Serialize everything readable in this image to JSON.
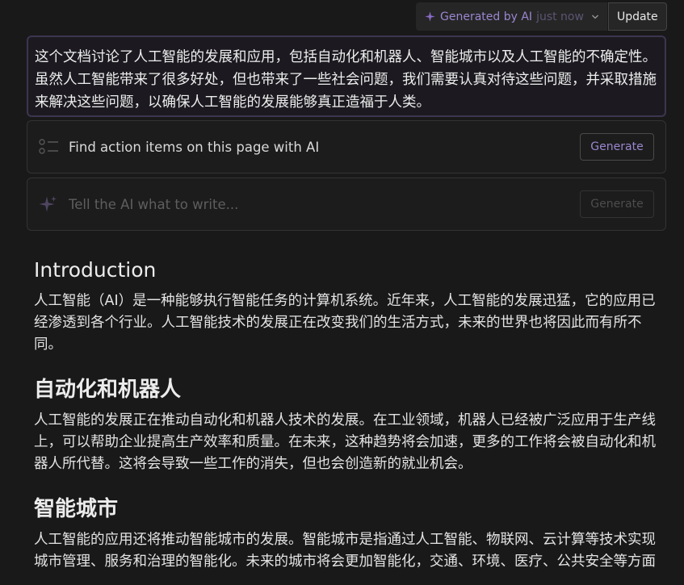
{
  "toolbar": {
    "generated_label": "Generated by AI",
    "generated_time": "just now",
    "update_label": "Update"
  },
  "summary": {
    "text": "这个文档讨论了人工智能的发展和应用，包括自动化和机器人、智能城市以及人工智能的不确定性。虽然人工智能带来了很多好处，但也带来了一些社会问题，我们需要认真对待这些问题，并采取措施来解决这些问题，以确保人工智能的发展能够真正造福于人类。"
  },
  "actions": {
    "find_items_label": "Find action items on this page with AI",
    "find_items_button": "Generate",
    "prompt_placeholder": "Tell the AI what to write...",
    "prompt_button": "Generate"
  },
  "doc": {
    "sections": [
      {
        "heading": "Introduction",
        "body": "人工智能（AI）是一种能够执行智能任务的计算机系统。近年来，人工智能的发展迅猛，它的应用已经渗透到各个行业。人工智能技术的发展正在改变我们的生活方式，未来的世界也将因此而有所不同。"
      },
      {
        "heading": "自动化和机器人",
        "body": "人工智能的发展正在推动自动化和机器人技术的发展。在工业领域，机器人已经被广泛应用于生产线上，可以帮助企业提高生产效率和质量。在未来，这种趋势将会加速，更多的工作将会被自动化和机器人所代替。这将会导致一些工作的消失，但也会创造新的就业机会。"
      },
      {
        "heading": "智能城市",
        "body": "人工智能的应用还将推动智能城市的发展。智能城市是指通过人工智能、物联网、云计算等技术实现城市管理、服务和治理的智能化。未来的城市将会更加智能化，交通、环境、医疗、公共安全等方面"
      }
    ]
  },
  "colors": {
    "background": "#191919",
    "ai_accent": "#9a86cf",
    "summary_border": "#3d3550"
  },
  "icons": {
    "toolbar": "sparkle-icon",
    "dropdown": "chevron-down-icon",
    "action_items": "checklist-icon",
    "prompt": "sparkle-icon"
  }
}
